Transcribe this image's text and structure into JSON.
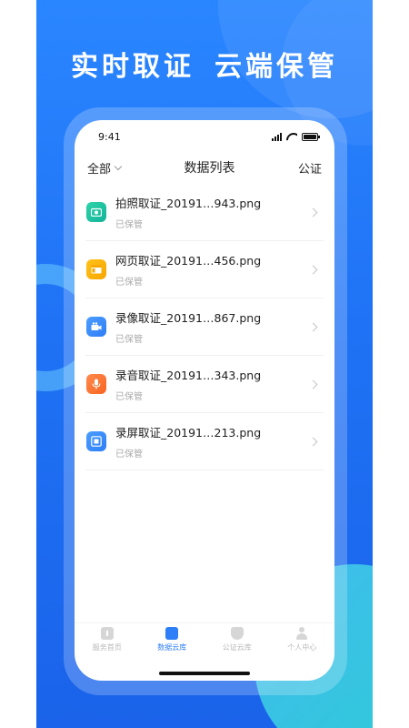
{
  "headline": {
    "part1": "实时取证",
    "part2": "云端保管"
  },
  "statusbar": {
    "time": "9:41"
  },
  "navbar": {
    "left_label": "全部",
    "title": "数据列表",
    "right_label": "公证"
  },
  "list": [
    {
      "title": "拍照取证_20191…943.png",
      "status": "已保管",
      "icon": "camera-icon",
      "color": "#1cc1a0"
    },
    {
      "title": "网页取证_20191…456.png",
      "status": "已保管",
      "icon": "webpage-icon",
      "color": "#fbb40c"
    },
    {
      "title": "录像取证_20191…867.png",
      "status": "已保管",
      "icon": "video-icon",
      "color": "#3d8cfb"
    },
    {
      "title": "录音取证_20191…343.png",
      "status": "已保管",
      "icon": "microphone-icon",
      "color": "#fb7536"
    },
    {
      "title": "录屏取证_20191…213.png",
      "status": "已保管",
      "icon": "screen-record-icon",
      "color": "#3d8cfb"
    }
  ],
  "tabbar": {
    "tabs": [
      {
        "label": "服务首页",
        "icon": "home-icon",
        "active": false
      },
      {
        "label": "数据云库",
        "icon": "folder-icon",
        "active": true
      },
      {
        "label": "公证云库",
        "icon": "shield-icon",
        "active": false
      },
      {
        "label": "个人中心",
        "icon": "user-icon",
        "active": false
      }
    ]
  },
  "colors": {
    "brand_blue": "#2d7ef7",
    "accent_teal": "#2fe0d0"
  }
}
